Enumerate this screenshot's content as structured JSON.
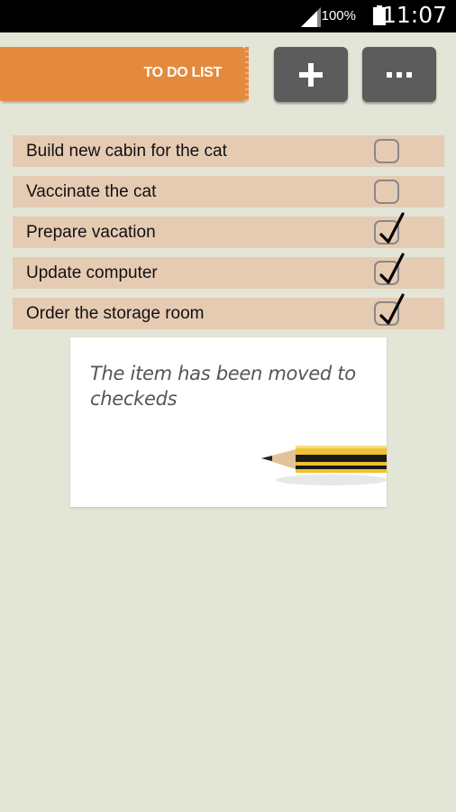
{
  "status_bar": {
    "battery_percent": "100%",
    "time": "11:07"
  },
  "header": {
    "title": "TO DO LIST",
    "add_label": "+",
    "more_label": "•••"
  },
  "todo_items": [
    {
      "label": "Build new cabin for the cat",
      "checked": false
    },
    {
      "label": "Vaccinate the cat",
      "checked": false
    },
    {
      "label": "Prepare vacation",
      "checked": true
    },
    {
      "label": "Update computer",
      "checked": true
    },
    {
      "label": "Order the storage room",
      "checked": true
    }
  ],
  "toast": {
    "message": "The item has been moved to checkeds"
  },
  "colors": {
    "background": "#e3e5d6",
    "accent": "#e48a3e",
    "row": "#e6cbb3",
    "button": "#5c5c5c"
  }
}
